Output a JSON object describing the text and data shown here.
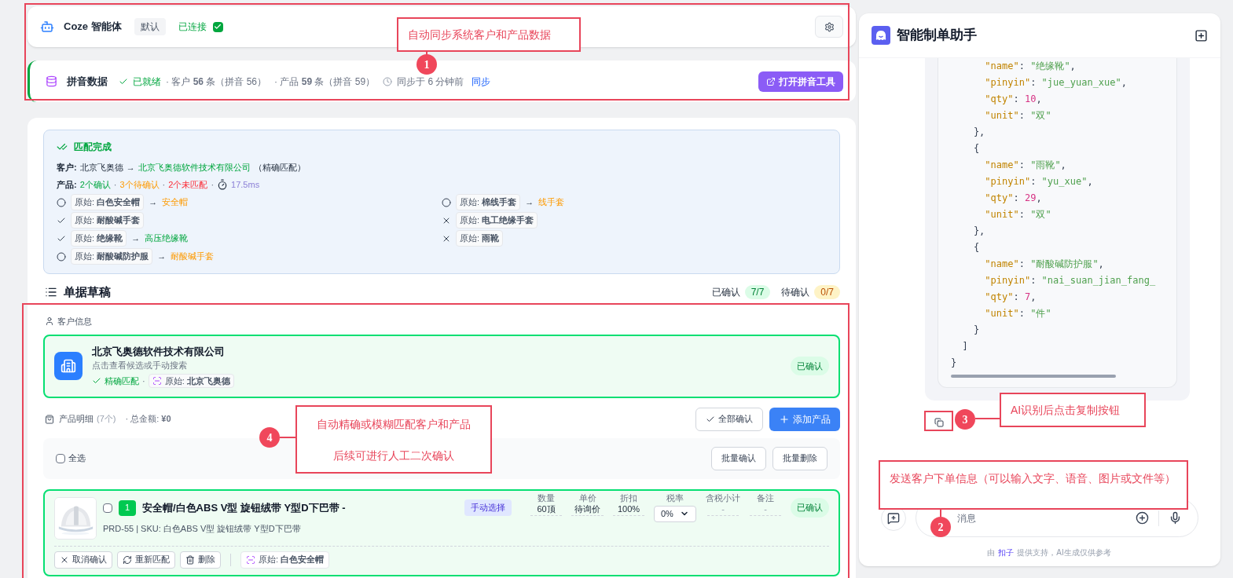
{
  "agent_bar": {
    "icon_label": "Coze 智能体",
    "tag": "默认",
    "status": "已连接",
    "connected": true
  },
  "pinyin_bar": {
    "title": "拼音数据",
    "status": "已就绪",
    "ready": true,
    "stats": [
      "· 客户 **56** 条（拼音 56）",
      "· 产品 **59** 条（拼音 59）"
    ],
    "sync_time": "同步于 6 分钟前",
    "sync_link": "同步",
    "open_button": "打开拼音工具"
  },
  "match": {
    "title": "匹配完成",
    "customer": {
      "label": "客户:",
      "original": "北京飞奥德",
      "arrow": "→",
      "target": "北京飞奥德软件技术有限公司",
      "note": "（精确匹配）"
    },
    "products": {
      "label": "产品:",
      "stats": [
        {
          "text": "2个确认",
          "kind": "confirmed"
        },
        {
          "text": "3个待确认",
          "kind": "pending"
        },
        {
          "text": "2个未匹配",
          "kind": "unmatched"
        }
      ],
      "sep": "·",
      "time": "17.5ms"
    },
    "items": [
      {
        "kind": "pending",
        "original": "原始: **白色安全帽**",
        "arrow": "→",
        "target": "安全帽"
      },
      {
        "kind": "pending",
        "original": "原始: **棉线手套**",
        "arrow": "→",
        "target": "线手套"
      },
      {
        "kind": "confirmed",
        "original": "原始: **耐酸碱手套**"
      },
      {
        "kind": "unmatched",
        "original": "原始: **电工绝缘手套**"
      },
      {
        "kind": "confirmed",
        "original": "原始: **绝缘靴**",
        "arrow": "→",
        "target": "高压绝缘靴"
      },
      {
        "kind": "unmatched",
        "original": "原始: **雨靴**"
      },
      {
        "kind": "pending",
        "original": "原始: **耐酸碱防护服**",
        "arrow": "→",
        "target": "耐酸碱手套"
      }
    ]
  },
  "draft": {
    "title": "单据草稿",
    "counts": [
      {
        "label": "已确认",
        "value": "7/7",
        "kind": "confirmed"
      },
      {
        "label": "待确认",
        "value": "0/7",
        "kind": "pending"
      }
    ],
    "customer_section": "客户信息",
    "customer": {
      "name": "北京飞奥德软件技术有限公司",
      "hint": "点击查看候选或手动搜索",
      "match": "精确匹配",
      "sep": "·",
      "original": "原始: **北京飞奥德**",
      "badge": "已确认",
      "confirmed": true
    },
    "products_label": "产品明细",
    "products_count": "(7个)",
    "total": "· 总金额: **¥0**",
    "confirm_all": "全部确认",
    "add_product": "添加产品",
    "select_all": {
      "label": "全选",
      "checked": false
    },
    "batch_confirm": "批量确认",
    "batch_delete": "批量删除",
    "product": {
      "checked": false,
      "index": "1",
      "title": "安全帽/白色ABS V型 旋钮绒带 Y型D下巴带 -",
      "tag": "手动选择",
      "sku": "PRD-55 | SKU: 白色ABS V型 旋钮绒带 Y型D下巴带",
      "fields": [
        {
          "label": "数量",
          "value": "60顶",
          "kind": "text"
        },
        {
          "label": "单价",
          "value": "待询价",
          "kind": "text"
        },
        {
          "label": "折扣",
          "value": "100%",
          "kind": "text"
        },
        {
          "label": "税率",
          "value": "0%",
          "kind": "select"
        },
        {
          "label": "含税小计",
          "value": "-",
          "kind": "muted"
        },
        {
          "label": "备注",
          "value": "-",
          "kind": "muted"
        }
      ],
      "badge": "已确认",
      "confirmed": true,
      "actions": [
        {
          "label": "取消确认",
          "kind": "cancel"
        },
        {
          "label": "重新匹配",
          "kind": "rematch"
        },
        {
          "label": "删除",
          "kind": "delete"
        }
      ],
      "original": "原始: **白色安全帽**"
    }
  },
  "assistant": {
    "title": "智能制单助手",
    "code": [
      {
        "key": "      \"name\"",
        "sep": ": ",
        "value": "\"绝缘靴\"",
        "kind": "string",
        "tail": ","
      },
      {
        "key": "      \"pinyin\"",
        "sep": ": ",
        "value": "\"jue_yuan_xue\"",
        "kind": "string",
        "tail": ","
      },
      {
        "key": "      \"qty\"",
        "sep": ": ",
        "value": "10",
        "kind": "number",
        "tail": ","
      },
      {
        "key": "      \"unit\"",
        "sep": ": ",
        "value": "\"双\"",
        "kind": "string"
      },
      {
        "punct": "    },"
      },
      {
        "punct": "    {"
      },
      {
        "key": "      \"name\"",
        "sep": ": ",
        "value": "\"雨靴\"",
        "kind": "string",
        "tail": ","
      },
      {
        "key": "      \"pinyin\"",
        "sep": ": ",
        "value": "\"yu_xue\"",
        "kind": "string",
        "tail": ","
      },
      {
        "key": "      \"qty\"",
        "sep": ": ",
        "value": "29",
        "kind": "number",
        "tail": ","
      },
      {
        "key": "      \"unit\"",
        "sep": ": ",
        "value": "\"双\"",
        "kind": "string"
      },
      {
        "punct": "    },"
      },
      {
        "punct": "    {"
      },
      {
        "key": "      \"name\"",
        "sep": ": ",
        "value": "\"耐酸碱防护服\"",
        "kind": "string",
        "tail": ","
      },
      {
        "key": "      \"pinyin\"",
        "sep": ": ",
        "value": "\"nai_suan_jian_fang_",
        "kind": "string"
      },
      {
        "key": "      \"qty\"",
        "sep": ": ",
        "value": "7",
        "kind": "number",
        "tail": ","
      },
      {
        "key": "      \"unit\"",
        "sep": ": ",
        "value": "\"件\"",
        "kind": "string"
      },
      {
        "punct": "    }"
      },
      {
        "punct": "  ]"
      },
      {
        "punct": "}"
      }
    ],
    "placeholder": "消息",
    "footer_prefix": "由",
    "footer_link": "扣子",
    "footer_suffix": "提供支持，AI生成仅供参考"
  },
  "annotations": [
    {
      "number": "1",
      "lines": [
        "自动同步系统客户和产品数据"
      ]
    },
    {
      "number": "4",
      "lines": [
        "自动精确或模糊匹配客户和产品",
        "后续可进行人工二次确认"
      ]
    },
    {
      "number": "3",
      "lines": [
        "AI识别后点击复制按钮"
      ]
    },
    {
      "number": "2",
      "lines": [
        "发送客户下单信息（可以输入文字、语音、图片或文件等）"
      ]
    }
  ]
}
